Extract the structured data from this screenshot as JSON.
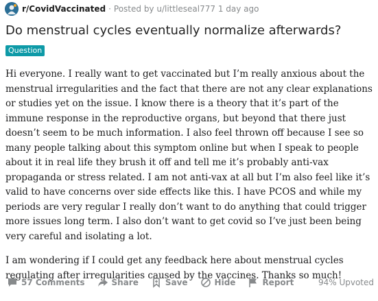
{
  "post": {
    "subreddit": "r/CovidVaccinated",
    "separator": "·",
    "posted_by": "Posted by u/littleseal777 1 day ago",
    "title": "Do menstrual cycles eventually normalize afterwards?",
    "flair": "Question",
    "paragraphs": [
      "Hi everyone. I really want to get vaccinated but I’m really anxious about the menstrual irregularities and the fact that there are not any clear explanations or studies yet on the issue. I know there is a theory that it’s part of the immune response in the reproductive organs, but beyond that there just doesn’t seem to be much information. I also feel thrown off because I see so many people talking about this symptom online but when I speak to people about it in real life they brush it off and tell me it’s probably anti-vax propaganda or stress related. I am not anti-vax at all but I’m also feel like it’s valid to have concerns over side effects like this. I have PCOS and while my periods are very regular I really don’t want to do anything that could trigger more issues long term. I also don’t want to get covid so I’ve just been being very careful and isolating a lot.",
      "I am wondering if I could get any feedback here about menstrual cycles regulating after irregularities caused by the vaccines. Thanks so much!"
    ]
  },
  "actions": {
    "comments": "57 Comments",
    "share": "Share",
    "save": "Save",
    "hide": "Hide",
    "report": "Report",
    "upvoted": "94% Upvoted"
  },
  "colors": {
    "flair_bg": "#0e9aa7",
    "meta_gray": "#878a8c"
  },
  "icons": [
    "subreddit-avatar-icon",
    "comment-icon",
    "share-icon",
    "save-icon",
    "hide-icon",
    "report-icon"
  ]
}
